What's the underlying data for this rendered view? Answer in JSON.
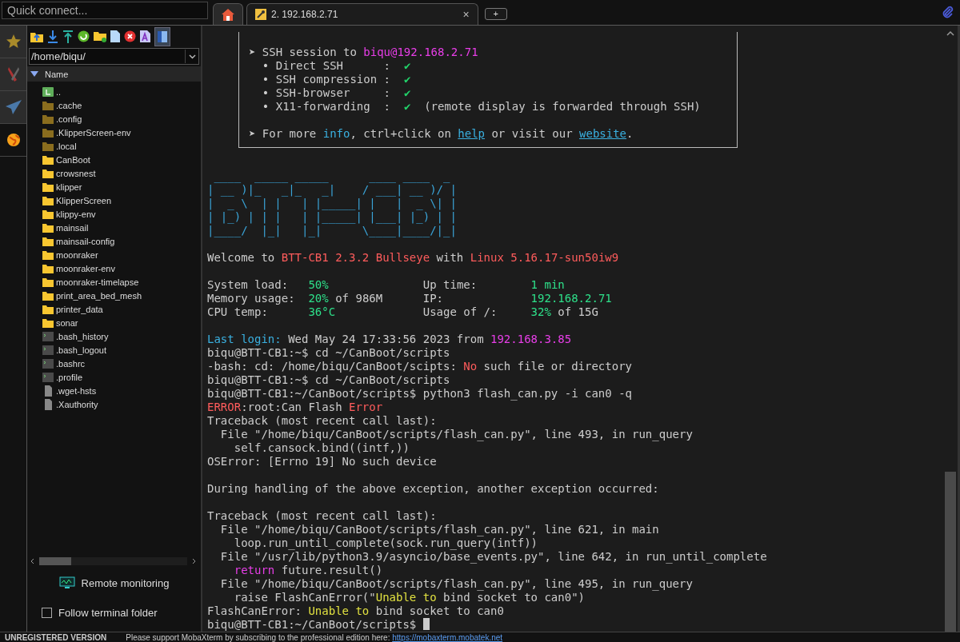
{
  "quick_connect": {
    "placeholder": "Quick connect..."
  },
  "tabs": [
    {
      "kind": "home",
      "selected": false
    },
    {
      "kind": "session",
      "label": "2. 192.168.2.71",
      "close": "×",
      "selected": true
    }
  ],
  "new_tab": "+",
  "side_tabs": [
    {
      "kind": "star",
      "selected": false
    },
    {
      "kind": "tools",
      "selected": false
    },
    {
      "kind": "send",
      "selected": false
    },
    {
      "kind": "sftp",
      "selected": true
    }
  ],
  "file_panel": {
    "path": "/home/biqu/",
    "column": "Name",
    "files": [
      {
        "kind": "parent",
        "name": ".."
      },
      {
        "kind": "hidden-folder",
        "name": ".cache"
      },
      {
        "kind": "hidden-folder",
        "name": ".config"
      },
      {
        "kind": "hidden-folder",
        "name": ".KlipperScreen-env"
      },
      {
        "kind": "hidden-folder",
        "name": ".local"
      },
      {
        "kind": "folder",
        "name": "CanBoot"
      },
      {
        "kind": "folder",
        "name": "crowsnest"
      },
      {
        "kind": "folder",
        "name": "klipper"
      },
      {
        "kind": "folder",
        "name": "KlipperScreen"
      },
      {
        "kind": "folder",
        "name": "klippy-env"
      },
      {
        "kind": "folder",
        "name": "mainsail"
      },
      {
        "kind": "folder",
        "name": "mainsail-config"
      },
      {
        "kind": "folder",
        "name": "moonraker"
      },
      {
        "kind": "folder",
        "name": "moonraker-env"
      },
      {
        "kind": "folder",
        "name": "moonraker-timelapse"
      },
      {
        "kind": "folder",
        "name": "print_area_bed_mesh"
      },
      {
        "kind": "folder",
        "name": "printer_data"
      },
      {
        "kind": "folder",
        "name": "sonar"
      },
      {
        "kind": "script",
        "name": ".bash_history"
      },
      {
        "kind": "script",
        "name": ".bash_logout"
      },
      {
        "kind": "script",
        "name": ".bashrc"
      },
      {
        "kind": "script",
        "name": ".profile"
      },
      {
        "kind": "file",
        "name": ".wget-hsts"
      },
      {
        "kind": "file",
        "name": ".Xauthority"
      }
    ],
    "remote_monitoring": "Remote monitoring",
    "follow_folder": {
      "label": "Follow terminal folder",
      "checked": false
    }
  },
  "terminal": {
    "box_lines": [
      {
        "kind": "blank"
      },
      {
        "segments": [
          {
            "text": "➤ SSH session to "
          },
          {
            "text": "biqu@192.168.2.71",
            "color": "#e83ee8"
          }
        ]
      },
      {
        "segments": [
          {
            "text": "  • Direct SSH      :  "
          },
          {
            "text": "✔",
            "color": "#22d36a"
          }
        ]
      },
      {
        "segments": [
          {
            "text": "  • SSH compression :  "
          },
          {
            "text": "✔",
            "color": "#22d36a"
          }
        ]
      },
      {
        "segments": [
          {
            "text": "  • SSH-browser     :  "
          },
          {
            "text": "✔",
            "color": "#22d36a"
          }
        ]
      },
      {
        "segments": [
          {
            "text": "  • X11-forwarding  :  "
          },
          {
            "text": "✔",
            "color": "#22d36a"
          },
          {
            "text": "  (remote display is forwarded through SSH)"
          }
        ]
      },
      {
        "kind": "blank"
      },
      {
        "segments": [
          {
            "text": "➤ For more "
          },
          {
            "text": "info",
            "color": "#3ab0e0"
          },
          {
            "text": ", ctrl+click on "
          },
          {
            "text": "help",
            "kind": "link"
          },
          {
            "text": " or visit our "
          },
          {
            "text": "website",
            "kind": "link"
          },
          {
            "text": "."
          }
        ]
      }
    ],
    "banner": [
      " ____  _____ _____      ____ ____  _ ",
      "| __ )|_   _|_   _|    / ___| __ )/ |",
      "|  _ \\  | |   | |_____| |   |  _ \\| |",
      "| |_) | | |   | |_____| |___| |_) | |",
      "|____/  |_|   |_|      \\____|____/|_|"
    ],
    "lines": [
      {
        "kind": "blank"
      },
      {
        "segments": [
          {
            "text": "Welcome to "
          },
          {
            "text": "BTT-CB1 2.3.2 Bullseye",
            "color": "#ff5c5c"
          },
          {
            "text": " with "
          },
          {
            "text": "Linux 5.16.17-sun50iw9",
            "color": "#ff5c5c"
          }
        ]
      },
      {
        "kind": "blank"
      },
      {
        "segments": [
          {
            "text": "System load:   "
          },
          {
            "text": "50%",
            "color": "#2ee08a"
          },
          {
            "text": "              Up time:        "
          },
          {
            "text": "1 min",
            "color": "#2ee08a"
          }
        ]
      },
      {
        "segments": [
          {
            "text": "Memory usage:  "
          },
          {
            "text": "20%",
            "color": "#2ee08a"
          },
          {
            "text": " of 986M      IP:             "
          },
          {
            "text": "192.168.2.71",
            "color": "#2ee08a"
          }
        ]
      },
      {
        "segments": [
          {
            "text": "CPU temp:      "
          },
          {
            "text": "36°C",
            "color": "#2ee08a"
          },
          {
            "text": "             Usage of /:     "
          },
          {
            "text": "32%",
            "color": "#2ee08a"
          },
          {
            "text": " of 15G"
          }
        ]
      },
      {
        "kind": "blank"
      },
      {
        "segments": [
          {
            "text": "Last login:",
            "color": "#3ab0e0"
          },
          {
            "text": " Wed May 24 17:33:56 2023 from "
          },
          {
            "text": "192.168.3.85",
            "color": "#e83ee8"
          }
        ]
      },
      {
        "segments": [
          {
            "text": "biqu@BTT-CB1:~$ cd ~/CanBoot/scripts"
          }
        ]
      },
      {
        "segments": [
          {
            "text": "-bash: cd: /home/biqu/CanBoot/scipts: "
          },
          {
            "text": "No",
            "color": "#ff5c5c"
          },
          {
            "text": " such file or directory"
          }
        ]
      },
      {
        "segments": [
          {
            "text": "biqu@BTT-CB1:~$ cd ~/CanBoot/scripts"
          }
        ]
      },
      {
        "segments": [
          {
            "text": "biqu@BTT-CB1:~/CanBoot/scripts$ python3 flash_can.py -i can0 -q"
          }
        ]
      },
      {
        "segments": [
          {
            "text": "ERROR",
            "color": "#ff5c5c"
          },
          {
            "text": ":root:Can Flash "
          },
          {
            "text": "Error",
            "color": "#ff5c5c"
          }
        ]
      },
      {
        "segments": [
          {
            "text": "Traceback (most recent call last):"
          }
        ]
      },
      {
        "segments": [
          {
            "text": "  File \"/home/biqu/CanBoot/scripts/flash_can.py\", line 493, in run_query"
          }
        ]
      },
      {
        "segments": [
          {
            "text": "    self.cansock.bind((intf,))"
          }
        ]
      },
      {
        "segments": [
          {
            "text": "OSError: [Errno 19] No such device"
          }
        ]
      },
      {
        "kind": "blank"
      },
      {
        "segments": [
          {
            "text": "During handling of the above exception, another exception occurred:"
          }
        ]
      },
      {
        "kind": "blank"
      },
      {
        "segments": [
          {
            "text": "Traceback (most recent call last):"
          }
        ]
      },
      {
        "segments": [
          {
            "text": "  File \"/home/biqu/CanBoot/scripts/flash_can.py\", line 621, in main"
          }
        ]
      },
      {
        "segments": [
          {
            "text": "    loop.run_until_complete(sock.run_query(intf))"
          }
        ]
      },
      {
        "segments": [
          {
            "text": "  File \"/usr/lib/python3.9/asyncio/base_events.py\", line 642, in run_until_complete"
          }
        ]
      },
      {
        "kind": "indented",
        "segments": [
          {
            "text": "return",
            "color": "#e83ee8"
          },
          {
            "text": " future.result()"
          }
        ]
      },
      {
        "segments": [
          {
            "text": "  File \"/home/biqu/CanBoot/scripts/flash_can.py\", line 495, in run_query"
          }
        ]
      },
      {
        "segments": [
          {
            "text": "    raise FlashCanError(\""
          },
          {
            "text": "Unable to",
            "color": "#e0e040"
          },
          {
            "text": " bind socket to can0\")"
          }
        ]
      },
      {
        "segments": [
          {
            "text": "FlashCanError: "
          },
          {
            "text": "Unable to",
            "color": "#e0e040"
          },
          {
            "text": " bind socket to can0"
          }
        ]
      },
      {
        "segments": [
          {
            "text": "biqu@BTT-CB1:~/CanBoot/scripts$ "
          }
        ],
        "cursor": true
      }
    ]
  },
  "status_bar": {
    "label": "UNREGISTERED VERSION",
    "message": "Please support MobaXterm by subscribing to the professional edition here:",
    "link": "https://mobaxterm.mobatek.net"
  }
}
